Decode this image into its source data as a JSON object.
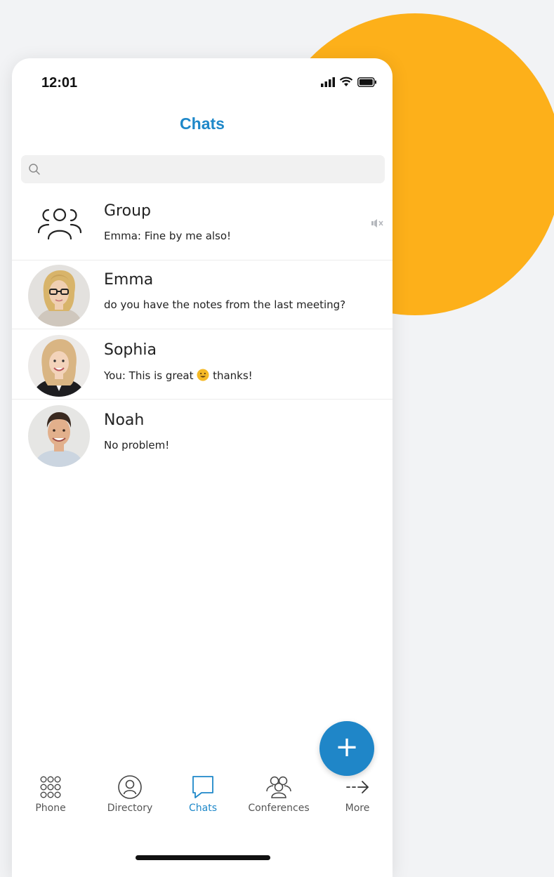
{
  "status": {
    "time": "12:01"
  },
  "header": {
    "title": "Chats"
  },
  "search": {
    "placeholder": ""
  },
  "chats": [
    {
      "name": "Group",
      "preview": "Emma: Fine by me also!",
      "muted": true
    },
    {
      "name": "Emma",
      "preview": "do you have the notes from the last meeting?"
    },
    {
      "name": "Sophia",
      "preview_before": "You: This is great",
      "preview_after": "thanks!",
      "emoji": "smiling-face"
    },
    {
      "name": "Noah",
      "preview": "No problem!"
    }
  ],
  "fab": {
    "label": "+"
  },
  "tabs": [
    {
      "label": "Phone",
      "icon": "dialpad-icon"
    },
    {
      "label": "Directory",
      "icon": "person-circle-icon"
    },
    {
      "label": "Chats",
      "icon": "chat-bubble-icon",
      "active": true
    },
    {
      "label": "Conferences",
      "icon": "people-icon"
    },
    {
      "label": "More",
      "icon": "arrow-right-icon"
    }
  ],
  "colors": {
    "accent": "#1e88c9",
    "circle": "#fdb01a",
    "fab": "#1f86c8"
  }
}
